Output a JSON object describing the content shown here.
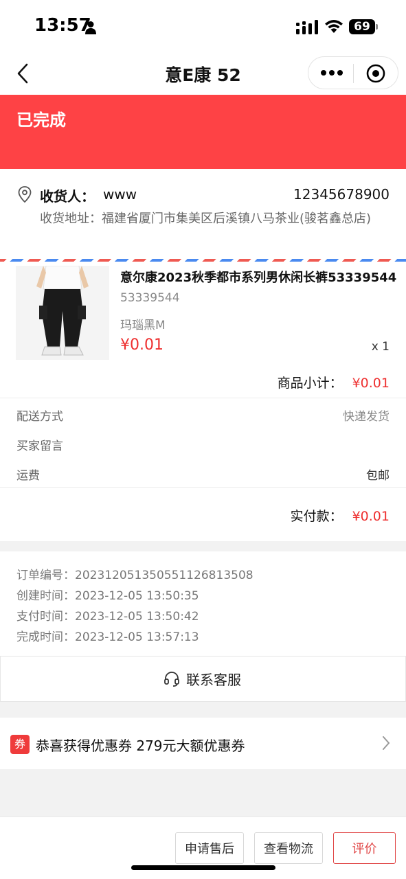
{
  "status_bar": {
    "time": "13:57",
    "battery": "69"
  },
  "nav": {
    "title": "意E康 52"
  },
  "order_status": {
    "label": "已完成"
  },
  "address": {
    "receiver_label": "收货人：",
    "receiver_name": "www",
    "phone": "12345678900",
    "address_line": "收货地址：福建省厦门市集美区后溪镇八马茶业(骏茗鑫总店)"
  },
  "product": {
    "name": "意尔康2023秋季都市系列男休闲长裤53339544",
    "code": "53339544",
    "spec": "玛瑙黑M",
    "price": "¥0.01",
    "quantity": "x 1"
  },
  "subtotal": {
    "label": "商品小计：",
    "amount": "¥0.01"
  },
  "delivery": {
    "method_label": "配送方式",
    "method_value": "快递发货",
    "message_label": "买家留言",
    "freight_label": "运费",
    "freight_value": "包邮"
  },
  "paid": {
    "label": "实付款：",
    "amount": "¥0.01"
  },
  "order_info": {
    "order_no": "订单编号：20231205135055112681350‌8",
    "created": "创建时间：2023-12-05 13:50:35",
    "paid": "支付时间：2023-12-05 13:50:42",
    "completed": "完成时间：2023-12-05 13:57:13"
  },
  "service": {
    "label": "联系客服"
  },
  "coupon": {
    "badge": "券",
    "text": "恭喜获得优惠券 279元大额优惠券"
  },
  "actions": {
    "after_sale": "申请售后",
    "logistics": "查看物流",
    "review": "评价"
  },
  "colors": {
    "accent": "#fe4245",
    "price": "#ee3030"
  },
  "icons": [
    "person-icon",
    "signal-icon",
    "wifi-icon",
    "back-icon",
    "more-icon",
    "target-icon",
    "pin-icon",
    "headset-icon",
    "chevron-right-icon"
  ]
}
